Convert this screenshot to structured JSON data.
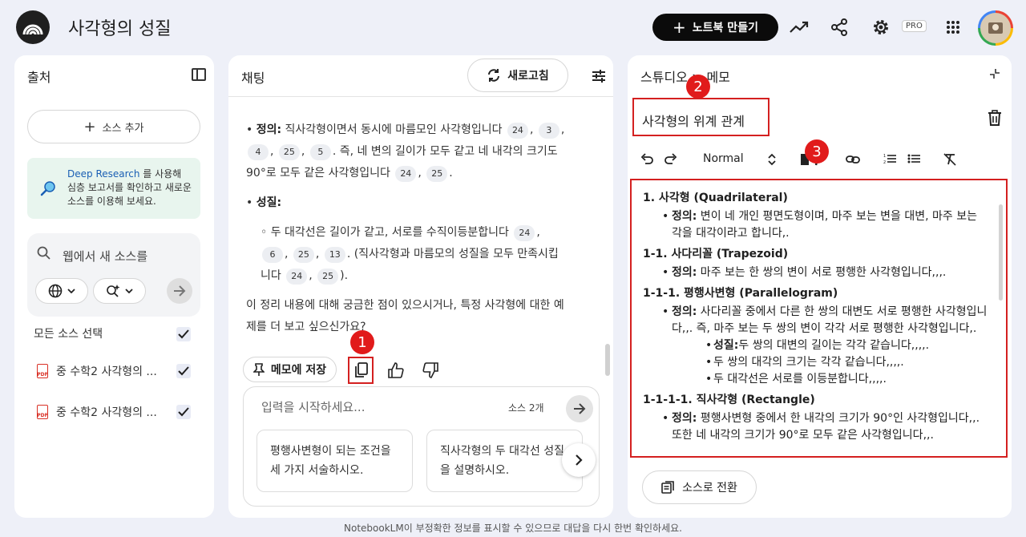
{
  "header": {
    "title": "사각형의 성질",
    "new_notebook_label": "노트북 만들기",
    "new_notebook_plus": "+",
    "pro_badge": "PRO"
  },
  "sources": {
    "title": "출처",
    "add_source_label": "소스 추가",
    "add_source_plus": "+",
    "deep_research_link": "Deep Research",
    "deep_research_text": " 를 사용해 심층 보고서를 확인하고 새로운 소스를 이용해 보세요.",
    "search_placeholder": "웹에서 새 소스를",
    "select_all_label": "모든 소스 선택",
    "pdf_tag": "PDF",
    "items": [
      {
        "label": "중 수학2 사각형의 ..."
      },
      {
        "label": "중 수학2 사각형의 ..."
      }
    ]
  },
  "chat": {
    "title": "채팅",
    "refresh_label": "새로고침",
    "definition_label": "정의:",
    "definition_text": " 직사각형이면서 동시에 마름모인 사각형입니다",
    "definition_text2": ". 즉, 네 변의 길이가 모두 같고 네 내각의 크기도 90°로 모두 같은 사각형입니다",
    "def_cites_a": [
      "24",
      "3",
      "4",
      "25",
      "5"
    ],
    "def_cites_b": [
      "24",
      "25"
    ],
    "property_label": "성질:",
    "property_bullet": "◦",
    "property_text": "두 대각선은 길이가 같고, 서로를 수직이등분합니다",
    "property_text2": ". (직사각형과 마름모의 성질을 모두 만족시킵니다",
    "property_text3": ").",
    "prop_cites_a": [
      "24",
      "6",
      "25",
      "13"
    ],
    "prop_cites_b": [
      "24",
      "25"
    ],
    "followup": "이 정리 내용에 대해 궁금한 점이 있으시거나, 특정 사각형에 대한 예제를 더 보고 싶으신가요?",
    "save_memo_label": "메모에 저장",
    "input_placeholder": "입력을 시작하세요...",
    "source_count": "소스 2개",
    "suggestions": [
      "평행사변형이 되는 조건을 세 가지 서술하시오.",
      "직사각형의 두 대각선 성질을 설명하시오."
    ]
  },
  "studio": {
    "crumb": "스튜디오 > 메모",
    "memo_title": "사각형의 위계 관계",
    "format_select": "Normal",
    "to_source_label": "소스로 전환",
    "memo": [
      {
        "type": "h",
        "text": "1. 사각형 (Quadrilateral)"
      },
      {
        "type": "l1",
        "label": "정의:",
        "text": " 변이 네 개인 평면도형이며, 마주 보는 변을 대변, 마주 보는 각을 대각이라고 합니다,."
      },
      {
        "type": "h",
        "text": "1-1. 사다리꼴 (Trapezoid)"
      },
      {
        "type": "l1",
        "label": "정의:",
        "text": " 마주 보는 한 쌍의 변이 서로 평행한 사각형입니다,,,."
      },
      {
        "type": "h",
        "text": "1-1-1. 평행사변형 (Parallelogram)"
      },
      {
        "type": "l1",
        "label": "정의:",
        "text": " 사다리꼴 중에서 다른 한 쌍의 대변도 서로 평행한 사각형입니다,,. 즉, 마주 보는 두 쌍의 변이 각각 서로 평행한 사각형입니다,."
      },
      {
        "type": "l2",
        "label": "성질:",
        "text": "두 쌍의 대변의 길이는 각각 같습니다,,,,."
      },
      {
        "type": "l2",
        "label": "",
        "text": "두 쌍의 대각의 크기는 각각 같습니다,,,,."
      },
      {
        "type": "l2",
        "label": "",
        "text": "두 대각선은 서로를 이등분합니다,,,,."
      },
      {
        "type": "h",
        "text": "1-1-1-1. 직사각형 (Rectangle)"
      },
      {
        "type": "l1",
        "label": "정의:",
        "text": " 평행사변형 중에서 한 내각의 크기가 90°인 사각형입니다,,. 또한 네 내각의 크기가 90°로 모두 같은 사각형입니다,,."
      }
    ]
  },
  "annotations": [
    "1",
    "2",
    "3"
  ],
  "footer": "NotebookLM이 부정확한 정보를 표시할 수 있으므로 대답을 다시 한번 확인하세요.",
  "colors": {
    "accent": "#0b0b0b",
    "highlight": "#d42020",
    "badge": "#e11b1b"
  }
}
